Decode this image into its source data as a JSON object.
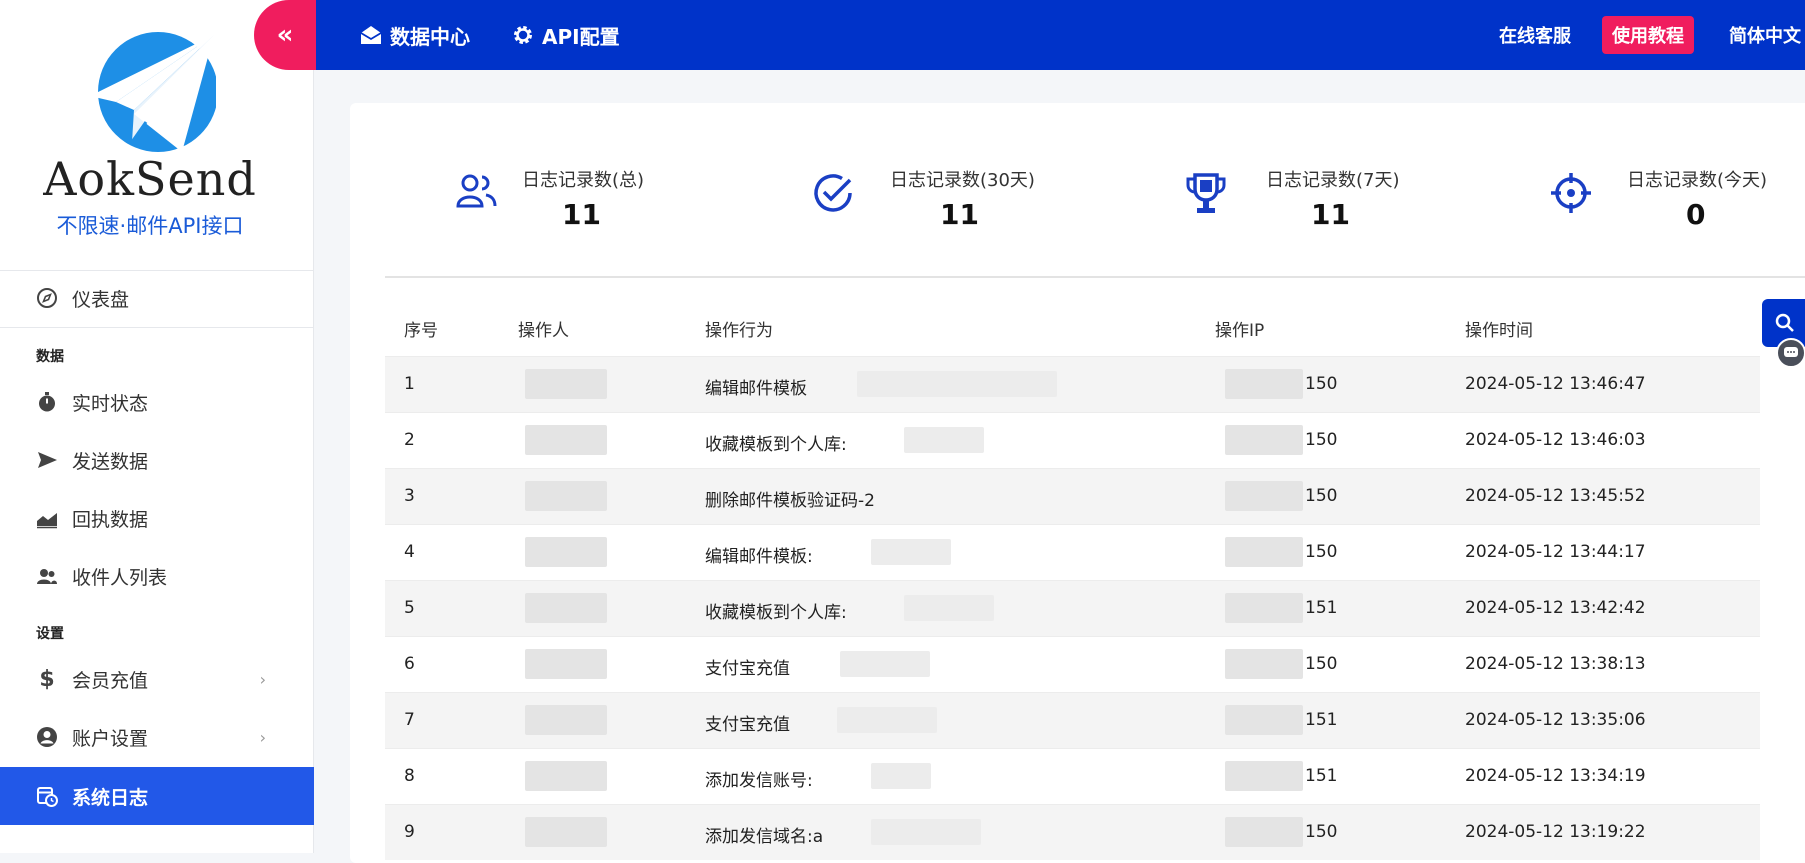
{
  "brand": {
    "name": "AokSend",
    "tagline": "不限速·邮件API接口"
  },
  "sidebar": {
    "dashboard": {
      "label": "仪表盘",
      "icon": "compass-icon"
    },
    "section_data": "数据",
    "data_items": [
      {
        "label": "实时状态",
        "icon": "stopwatch-icon"
      },
      {
        "label": "发送数据",
        "icon": "send-icon"
      },
      {
        "label": "回执数据",
        "icon": "chart-area-icon"
      },
      {
        "label": "收件人列表",
        "icon": "users-icon"
      }
    ],
    "section_settings": "设置",
    "settings_items": [
      {
        "label": "会员充值",
        "icon": "dollar-icon"
      },
      {
        "label": "账户设置",
        "icon": "user-circle-icon"
      }
    ],
    "active_item": {
      "label": "系统日志",
      "icon": "calendar-clock-icon"
    }
  },
  "topbar": {
    "nav": [
      {
        "label": "数据中心",
        "icon": "envelope-open-icon"
      },
      {
        "label": "API配置",
        "icon": "gear-icon"
      }
    ],
    "support": "在线客服",
    "tutorial": "使用教程",
    "language": "简体中文"
  },
  "stats": [
    {
      "label": "日志记录数(总)",
      "value": "11",
      "icon": "users-icon"
    },
    {
      "label": "日志记录数(30天)",
      "value": "11",
      "icon": "check-circle-icon"
    },
    {
      "label": "日志记录数(7天)",
      "value": "11",
      "icon": "trophy-icon"
    },
    {
      "label": "日志记录数(今天)",
      "value": "0",
      "icon": "crosshair-icon"
    }
  ],
  "table": {
    "headers": {
      "index": "序号",
      "operator": "操作人",
      "action": "操作行为",
      "ip": "操作IP",
      "time": "操作时间"
    },
    "rows": [
      {
        "index": "1",
        "action": "编辑邮件模板",
        "ip": "150",
        "time": "2024-05-12 13:46:47"
      },
      {
        "index": "2",
        "action": "收藏模板到个人库:",
        "ip": "150",
        "time": "2024-05-12 13:46:03"
      },
      {
        "index": "3",
        "action": "删除邮件模板验证码-2",
        "ip": "150",
        "time": "2024-05-12 13:45:52"
      },
      {
        "index": "4",
        "action": "编辑邮件模板:",
        "ip": "150",
        "time": "2024-05-12 13:44:17"
      },
      {
        "index": "5",
        "action": "收藏模板到个人库:",
        "ip": "151",
        "time": "2024-05-12 13:42:42"
      },
      {
        "index": "6",
        "action": "支付宝充值",
        "ip": "150",
        "time": "2024-05-12 13:38:13"
      },
      {
        "index": "7",
        "action": "支付宝充值",
        "ip": "151",
        "time": "2024-05-12 13:35:06"
      },
      {
        "index": "8",
        "action": "添加发信账号:",
        "ip": "151",
        "time": "2024-05-12 13:34:19"
      },
      {
        "index": "9",
        "action": "添加发信域名:a",
        "ip": "150",
        "time": "2024-05-12 13:19:22"
      }
    ]
  },
  "colors": {
    "primary": "#0033c9",
    "accent": "#f01d5e",
    "active": "#2258e8",
    "logo_blue": "#1e8fe6"
  }
}
